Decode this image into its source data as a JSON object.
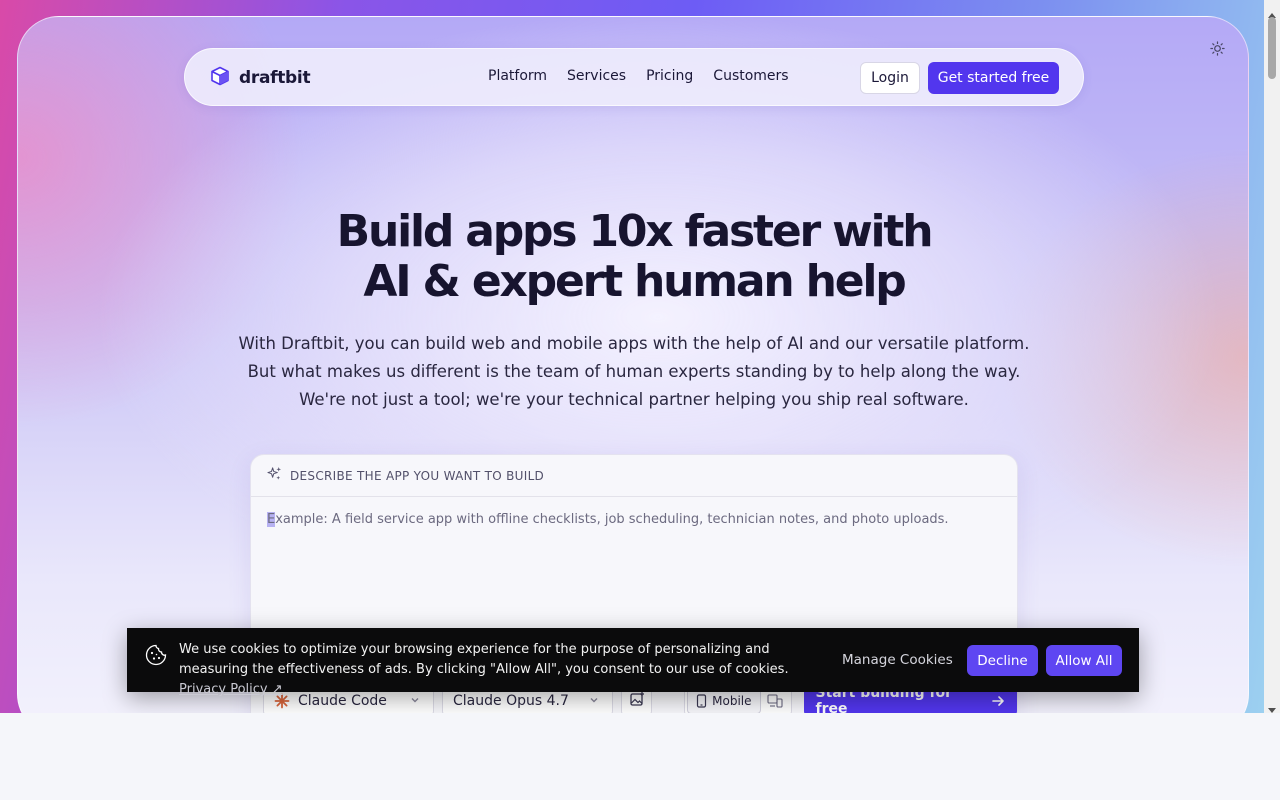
{
  "nav": {
    "brand": "draftbit",
    "links": [
      "Platform",
      "Services",
      "Pricing",
      "Customers"
    ],
    "login_label": "Login",
    "cta_label": "Get started free",
    "theme_icon": "sun-icon"
  },
  "hero": {
    "headline_line1": "Build apps 10x faster with",
    "headline_line2": "AI & expert human help",
    "subtext": "With Draftbit, you can build web and mobile apps with the help of AI and our versatile platform. But what makes us different is the team of human experts standing by to help along the way. We're not just a tool; we're your technical partner helping you ship real software."
  },
  "prompt": {
    "label": "DESCRIBE THE APP YOU WANT TO BUILD",
    "placeholder_first": "E",
    "placeholder_rest": "xample: A field service app with offline checklists, job scheduling, technician notes, and photo uploads.",
    "agent_select": "Claude Code",
    "model_select": "Claude Opus 4.7",
    "platform_active": "Mobile",
    "start_label": "Start building for free"
  },
  "cookie": {
    "message": "We use cookies to optimize your browsing experience for the purpose of personalizing and measuring the effectiveness of ads. By clicking \"Allow All\", you consent to our use of cookies.",
    "policy_link": "Privacy Policy ↗",
    "manage_label": "Manage Cookies",
    "decline_label": "Decline",
    "allow_label": "Allow All"
  },
  "colors": {
    "brand": "#5236ee",
    "cookie_bg": "#0b0b0c"
  }
}
